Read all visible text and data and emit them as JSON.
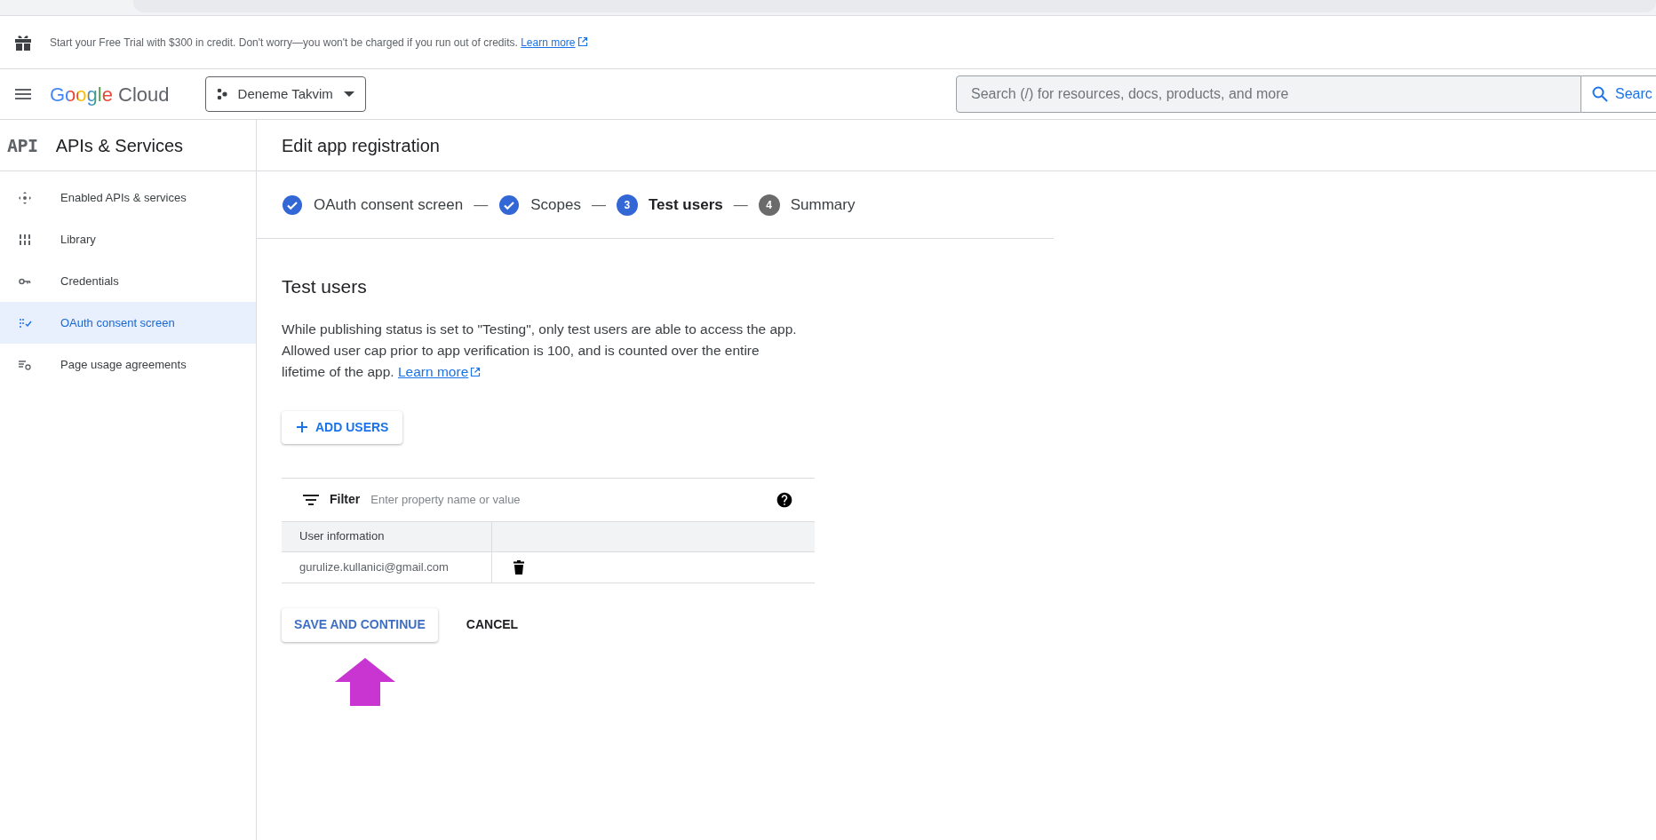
{
  "banner": {
    "text": "Start your Free Trial with $300 in credit. Don't worry—you won't be charged if you run out of credits.",
    "link": "Learn more"
  },
  "header": {
    "logo": {
      "brand": "Google",
      "product": "Cloud"
    },
    "project": "Deneme Takvim",
    "search": {
      "placeholder": "Search (/) for resources, docs, products, and more",
      "button": "Searc"
    }
  },
  "sidebar": {
    "badge": "API",
    "title": "APIs & Services",
    "items": [
      {
        "label": "Enabled APIs & services",
        "selected": false
      },
      {
        "label": "Library",
        "selected": false
      },
      {
        "label": "Credentials",
        "selected": false
      },
      {
        "label": "OAuth consent screen",
        "selected": true
      },
      {
        "label": "Page usage agreements",
        "selected": false
      }
    ]
  },
  "page": {
    "title": "Edit app registration",
    "steps": [
      {
        "label": "OAuth consent screen",
        "completed": true,
        "selected": false
      },
      {
        "label": "Scopes",
        "completed": true,
        "selected": false
      },
      {
        "label": "Test users",
        "completed": false,
        "selected": true,
        "number": "3"
      },
      {
        "label": "Summary",
        "completed": false,
        "selected": false,
        "number": "4"
      }
    ],
    "separator": "—",
    "section": {
      "title": "Test users",
      "description": "While publishing status is set to \"Testing\", only test users are able to access the app. Allowed user cap prior to app verification is 100, and is counted over the entire lifetime of the app.",
      "link": "Learn more"
    },
    "add_button": "ADD USERS",
    "table": {
      "filter_label": "Filter",
      "filter_placeholder": "Enter property name or value",
      "columns": [
        "User information"
      ],
      "rows": [
        {
          "email": "gurulize.kullanici@gmail.com"
        }
      ]
    },
    "buttons": [
      {
        "label": "SAVE AND CONTINUE",
        "kind": "primary"
      },
      {
        "label": "CANCEL",
        "kind": "text"
      }
    ]
  }
}
